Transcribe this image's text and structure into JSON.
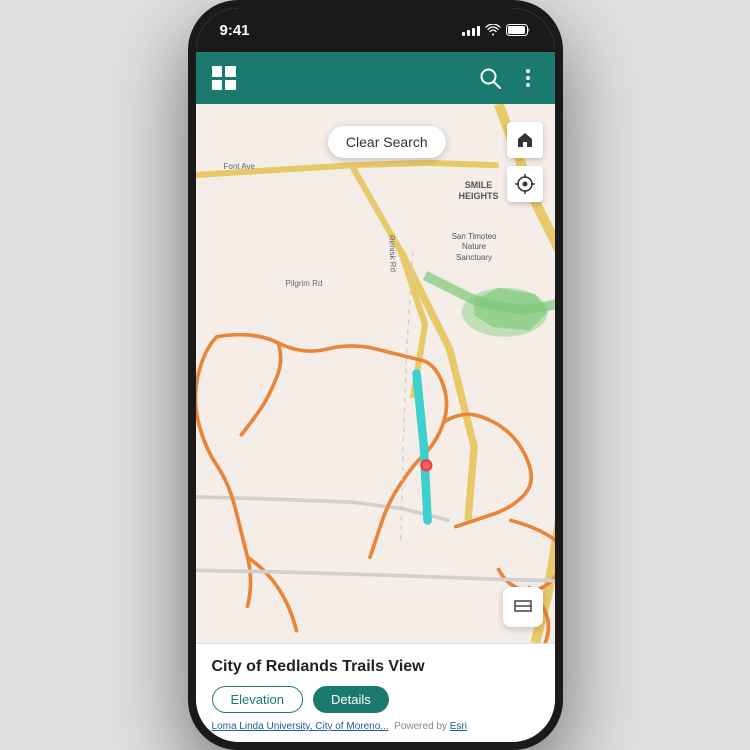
{
  "status_bar": {
    "time": "9:41"
  },
  "header": {
    "search_icon_label": "search",
    "more_icon_label": "more options"
  },
  "map": {
    "clear_search_label": "Clear Search",
    "smile_heights_label": "SMILE\nHEIGHTS",
    "san_timoteo_label": "San Timoteo\nNature\nSanctuary",
    "pilgrim_rd_label": "Pilgrim Rd",
    "font_ave_label": "Font Ave",
    "rehisk_rd_label": "Rehisk Rd"
  },
  "bottom_panel": {
    "title": "City of Redlands Trails View",
    "elevation_btn": "Elevation",
    "details_btn": "Details",
    "attribution": "Loma Linda University, City of Moreno...",
    "esri_link": "Esri"
  },
  "colors": {
    "teal": "#1a7a6e",
    "trail_orange": "#e8853a",
    "trail_teal": "#3ecfcf",
    "green_nature": "#7dc87a",
    "map_bg": "#f5ede8",
    "road_yellow": "#e8c96a"
  }
}
